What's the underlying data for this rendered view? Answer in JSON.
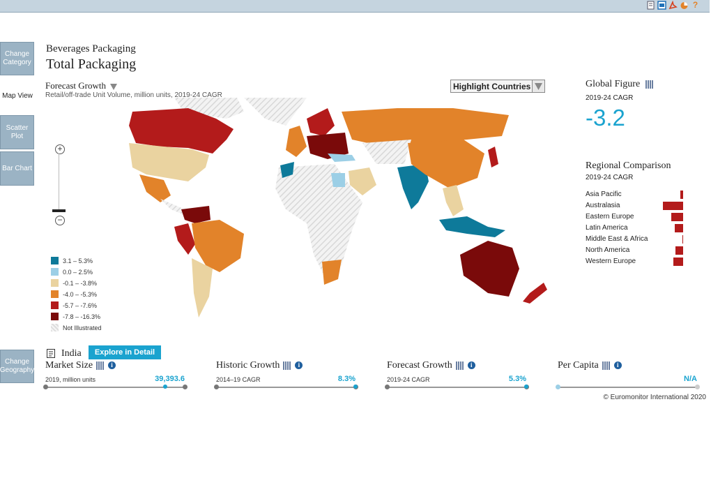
{
  "toolbar": {
    "icons": [
      "print-icon",
      "image-icon",
      "pdf-icon",
      "pie-chart-icon",
      "help-icon"
    ]
  },
  "nav": {
    "change_category": "Change Category",
    "map_view": "Map View",
    "scatter_plot": "Scatter Plot",
    "bar_chart": "Bar Chart",
    "change_geography": "Change Geography"
  },
  "header": {
    "category": "Beverages Packaging",
    "subcategory": "Total Packaging",
    "metric": "Forecast Growth",
    "description": "Retail/off-trade Unit Volume, million units, 2019-24 CAGR",
    "highlight_label": "Highlight Countries"
  },
  "legend": [
    {
      "label": "3.1 – 5.3%",
      "color": "#0e7a9a"
    },
    {
      "label": "0.0 – 2.5%",
      "color": "#9ccfe6"
    },
    {
      "label": "-0.1 – -3.8%",
      "color": "#ead3a0"
    },
    {
      "label": "-4.0 – -5.3%",
      "color": "#e2832a"
    },
    {
      "label": "-5.7 – -7.6%",
      "color": "#b31b1b"
    },
    {
      "label": "-7.8 – -16.3%",
      "color": "#7a0a0a"
    },
    {
      "label": "Not Illustrated",
      "color": "hatch"
    }
  ],
  "global": {
    "title": "Global Figure",
    "period": "2019-24 CAGR",
    "value": "-3.2"
  },
  "regional": {
    "title": "Regional Comparison",
    "period": "2019-24 CAGR",
    "rows": [
      {
        "name": "Asia Pacific",
        "value": -0.8
      },
      {
        "name": "Australasia",
        "value": -6.0
      },
      {
        "name": "Eastern Europe",
        "value": -3.5
      },
      {
        "name": "Latin America",
        "value": -2.5
      },
      {
        "name": "Middle East & Africa",
        "value": -0.2
      },
      {
        "name": "North America",
        "value": -2.2
      },
      {
        "name": "Western Europe",
        "value": -2.8
      }
    ]
  },
  "geography": {
    "name": "India",
    "explore": "Explore in Detail"
  },
  "metrics": [
    {
      "title": "Market Size",
      "sub": "2019, million units",
      "value": "39,393.6",
      "pos": 0.86
    },
    {
      "title": "Historic Growth",
      "sub": "2014–19 CAGR",
      "value": "8.3%",
      "pos": 1.0
    },
    {
      "title": "Forecast Growth",
      "sub": "2019-24 CAGR",
      "value": "5.3%",
      "pos": 1.0
    },
    {
      "title": "Per Capita",
      "sub": "",
      "value": "N/A",
      "pos": 0.0
    }
  ],
  "copyright": "© Euromonitor International 2020"
}
